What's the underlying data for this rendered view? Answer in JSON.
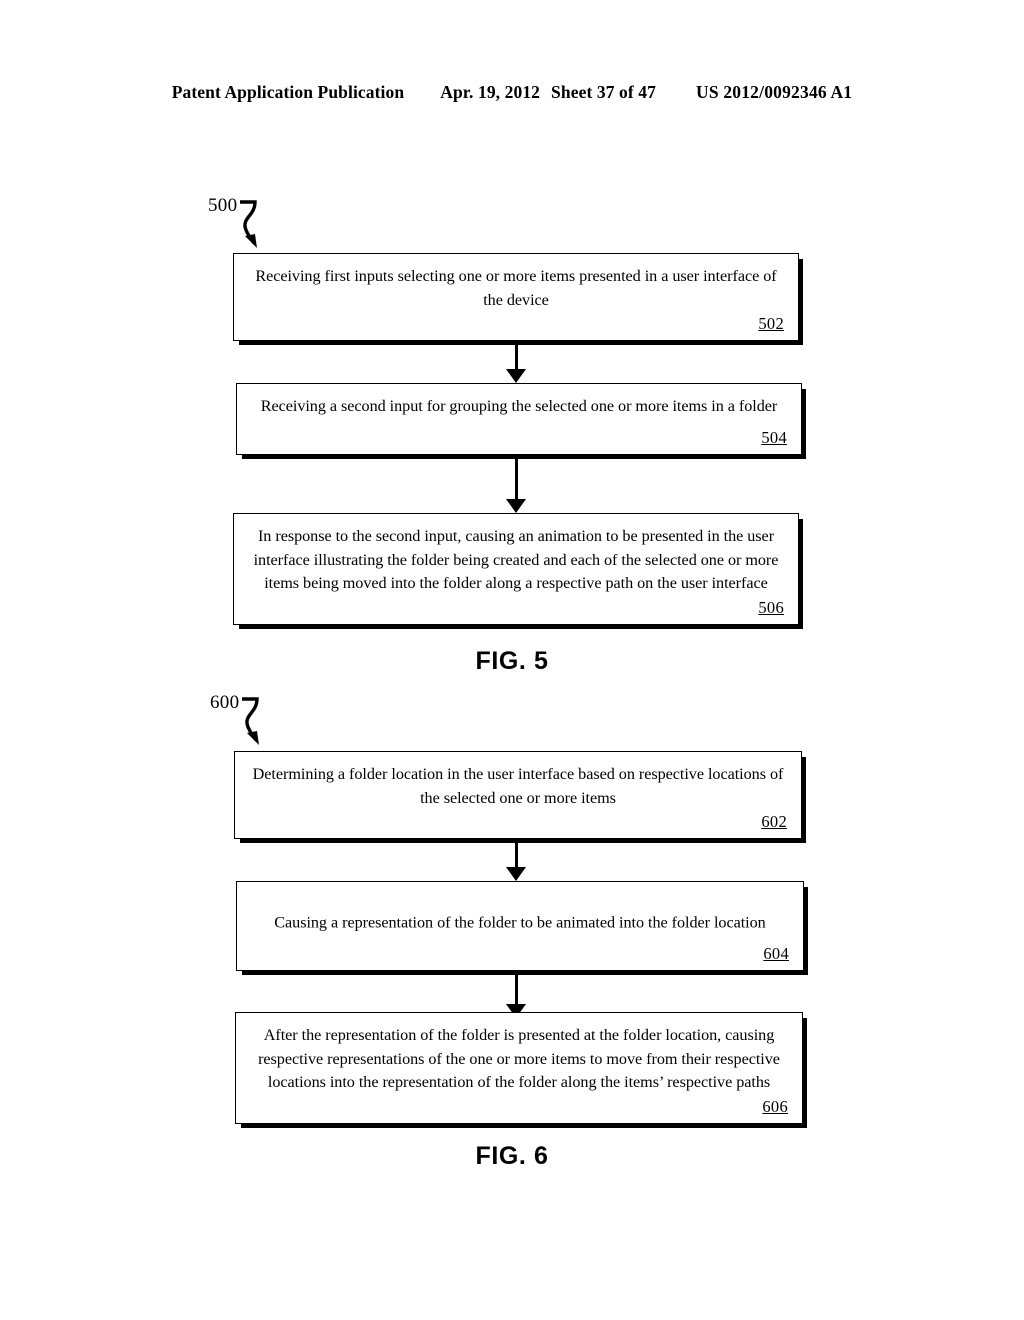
{
  "header": {
    "publication": "Patent Application Publication",
    "date": "Apr. 19, 2012",
    "sheet": "Sheet 37 of 47",
    "patent_number": "US 2012/0092346 A1"
  },
  "figures": [
    {
      "id": "figure-5",
      "lead_label": "500",
      "caption": "FIG. 5",
      "steps": [
        {
          "text": "Receiving first inputs selecting one or more items presented in a user interface of the device",
          "ref": "502"
        },
        {
          "text": "Receiving a second input for grouping the selected one or more items in a folder",
          "ref": "504"
        },
        {
          "text": "In response to the second input, causing an animation to be presented in the user interface illustrating the folder being created and each of the selected one or more items being moved into the folder along a respective path on the user interface",
          "ref": "506"
        }
      ]
    },
    {
      "id": "figure-6",
      "lead_label": "600",
      "caption": "FIG. 6",
      "steps": [
        {
          "text": "Determining a folder location in the user interface based on respective locations of the selected one or more items",
          "ref": "602"
        },
        {
          "text": "Causing a representation of the folder to be animated into the folder location",
          "ref": "604"
        },
        {
          "text": "After the representation of the folder is presented at the folder location, causing respective representations of the one or more items to move from their respective locations into the representation of the folder along the items’ respective paths",
          "ref": "606"
        }
      ]
    }
  ],
  "colors": {
    "ink": "#000000",
    "paper": "#ffffff"
  }
}
